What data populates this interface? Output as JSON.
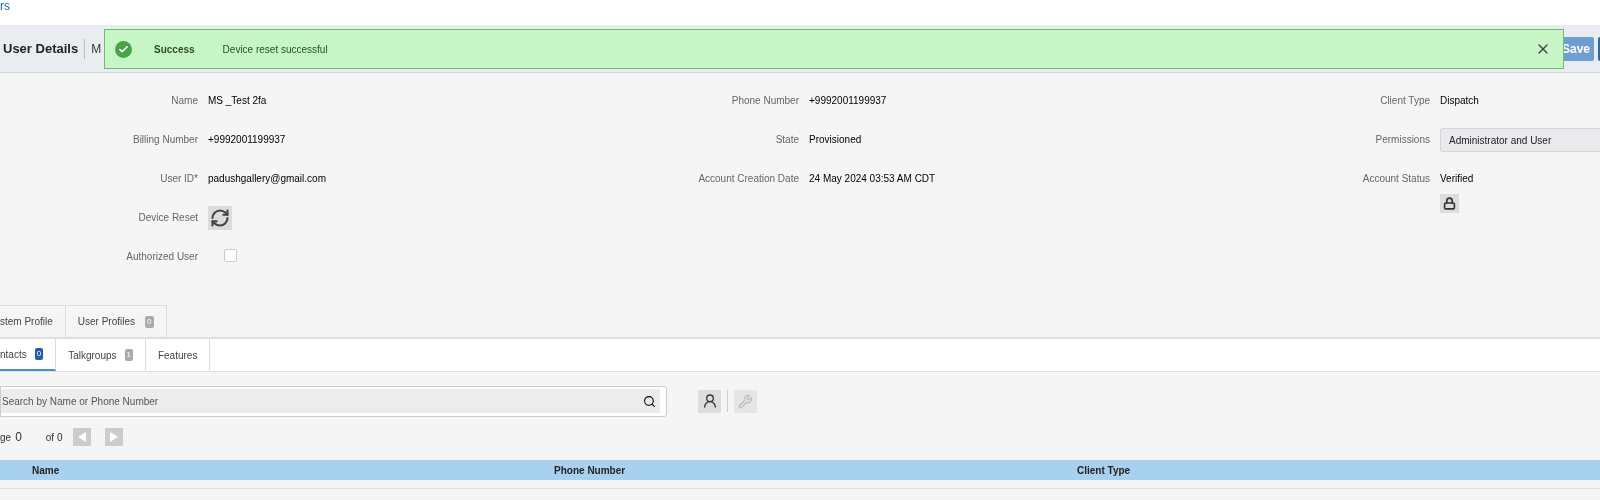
{
  "top_link": "rs",
  "header": {
    "title": "User Details",
    "subtitle": "M",
    "buttons": [
      {
        "label": "Save"
      }
    ]
  },
  "toast": {
    "title": "Success",
    "message": "Device reset successful"
  },
  "form": {
    "columns": [
      [
        {
          "kind": "text",
          "label": "Name",
          "value": "MS _Test 2fa"
        },
        {
          "kind": "text",
          "label": "Billing Number",
          "value": "+9992001199937"
        },
        {
          "kind": "text",
          "label": "User ID*",
          "value": "padushgallery@gmail.com"
        },
        {
          "kind": "reset",
          "label": "Device Reset"
        },
        {
          "kind": "checkbox",
          "label": "Authorized User",
          "checked": false
        }
      ],
      [
        {
          "kind": "text",
          "label": "Phone Number",
          "value": "+9992001199937"
        },
        {
          "kind": "text",
          "label": "State",
          "value": "Provisioned"
        },
        {
          "kind": "text",
          "label": "Account Creation Date",
          "value": "24 May 2024 03:53 AM CDT"
        }
      ],
      [
        {
          "kind": "text",
          "label": "Client Type",
          "value": "Dispatch"
        },
        {
          "kind": "select",
          "label": "Permissions",
          "value": "Administrator and User"
        },
        {
          "kind": "status",
          "label": "Account Status",
          "value": "Verified"
        }
      ]
    ]
  },
  "profile_tabs": [
    {
      "label": "stem Profile"
    },
    {
      "label": "User Profiles",
      "count": "0"
    }
  ],
  "sub_tabs": [
    {
      "label": "ntacts",
      "count": "0",
      "selected": true
    },
    {
      "label": "Talkgroups",
      "count": "1",
      "selected": false
    },
    {
      "label": "Features",
      "selected": false
    }
  ],
  "search": {
    "placeholder": "Search by Name or Phone Number"
  },
  "pager": {
    "label": "ge",
    "page": "0",
    "total": "of 0"
  },
  "table": {
    "columns": [
      "Name",
      "Phone Number",
      "Client Type"
    ]
  }
}
